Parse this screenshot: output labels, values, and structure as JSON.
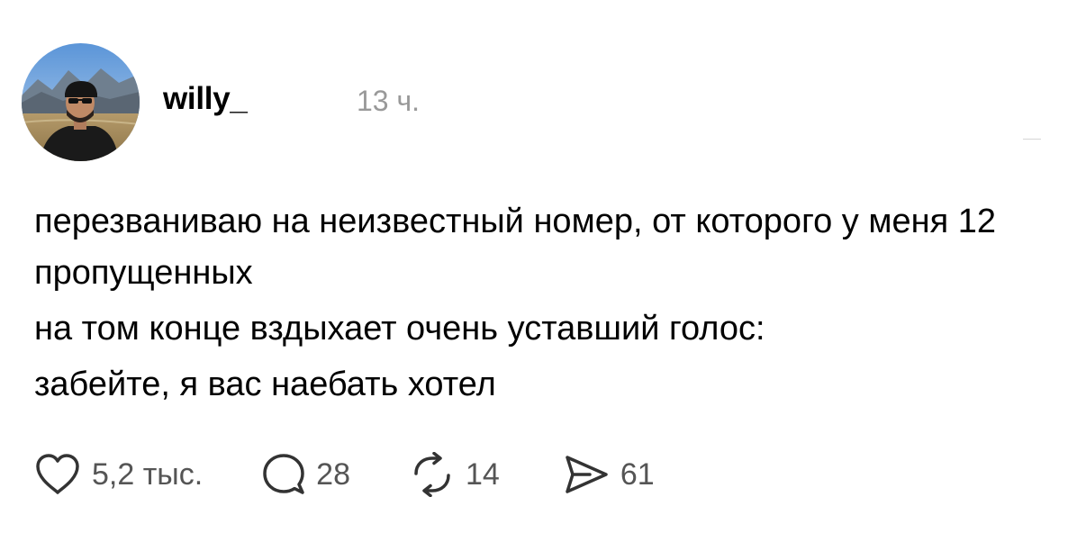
{
  "post": {
    "author": {
      "username": "willy_",
      "avatar_icon": "profile-photo-man-in-mountains"
    },
    "time": "13 ч.",
    "text_paragraphs": [
      "перезваниваю на неизвестный номер, от которого у меня 12 пропущенных",
      "на том конце вздыхает очень уставший голос:",
      "забейте, я вас наебать хотел"
    ],
    "actions": {
      "likes": "5,2 тыс.",
      "comments": "28",
      "reposts": "14",
      "shares": "61"
    },
    "icons": {
      "like": "heart-icon",
      "comment": "comment-bubble-icon",
      "repost": "repost-icon",
      "share": "send-icon"
    },
    "colors": {
      "text": "#000000",
      "secondary": "#999999",
      "count": "#555555",
      "icon": "#333333"
    }
  }
}
